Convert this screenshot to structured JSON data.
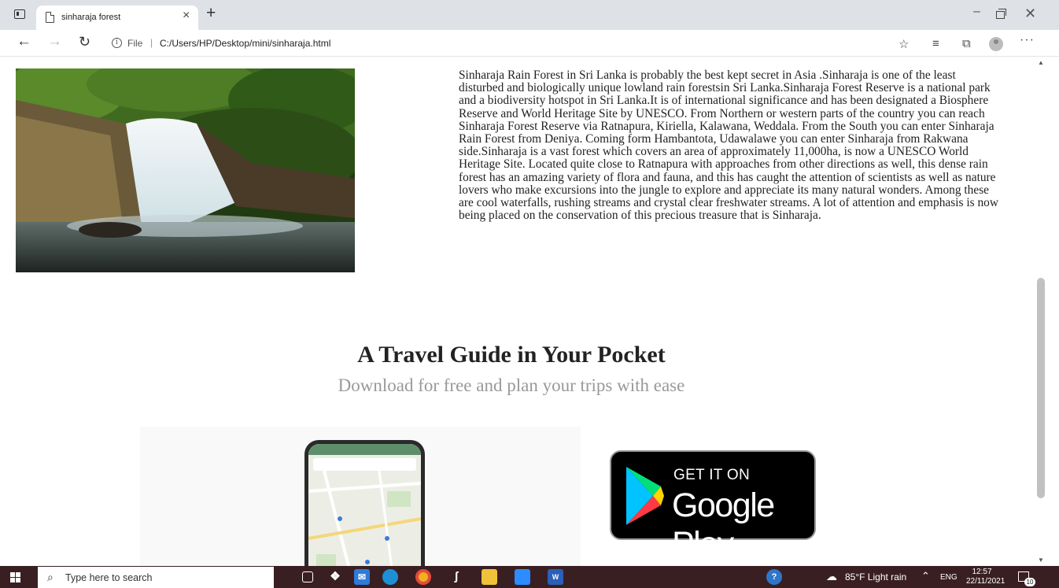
{
  "browser": {
    "tab_title": "sinharaja forest",
    "tab_close": "×",
    "new_tab": "+",
    "address": {
      "security_label": "File",
      "separator": "|",
      "url": "C:/Users/HP/Desktop/mini/sinharaja.html"
    },
    "window_controls": {
      "minimize": "–",
      "close": "✕"
    },
    "toolbar": {
      "more": "···"
    }
  },
  "page": {
    "description": "Sinharaja Rain Forest in Sri Lanka is probably the best kept secret in Asia .Sinharaja is one of the least disturbed and biologically unique lowland rain forestsin Sri Lanka.Sinharaja Forest Reserve is a national park and a biodiversity hotspot in Sri Lanka.It is of international significance and has been designated a Biosphere Reserve and World Heritage Site by UNESCO. From Northern or western parts of the country you can reach Sinharaja Forest Reserve via Ratnapura, Kiriella, Kalawana, Weddala. From the South you can enter Sinharaja Rain Forest from Deniya. Coming form Hambantota, Udawalawe you can enter Sinharaja from Rakwana side.Sinharaja is a vast forest which covers an area of approximately 11,000ha, is now a UNESCO World Heritage Site. Located quite close to Ratnapura with approaches from other directions as well, this dense rain forest has an amazing variety of flora and fauna, and this has caught the attention of scientists as well as nature lovers who make excursions into the jungle to explore and appreciate its many natural wonders. Among these are cool waterfalls, rushing streams and crystal clear freshwater streams. A lot of attention and emphasis is now being placed on the conservation of this precious treasure that is Sinharaja.",
    "promo_title": "A Travel Guide in Your Pocket",
    "promo_subtitle": "Download for free and plan your trips with ease",
    "store_badge": {
      "small": "GET IT ON",
      "big": "Google Play"
    }
  },
  "taskbar": {
    "search_placeholder": "Type here to search",
    "weather": "85°F  Light rain",
    "language": "ENG",
    "time": "12:57",
    "date": "22/11/2021",
    "notification_count": "10"
  },
  "icons": [
    "tab-actions-icon",
    "page-icon",
    "back-icon",
    "forward-icon",
    "reload-icon",
    "info-icon",
    "add-favorite-icon",
    "favorites-icon",
    "collections-icon",
    "profile-icon",
    "more-icon",
    "windows-start-icon",
    "search-icon",
    "task-view-icon",
    "dropbox-icon",
    "mail-icon",
    "edge-icon",
    "chrome-icon",
    "app-icon",
    "file-explorer-icon",
    "zoom-icon",
    "word-icon",
    "help-icon",
    "weather-icon",
    "chevron-up-icon",
    "notification-icon"
  ],
  "colors": {
    "taskbar": "#3a1f22",
    "tabstrip": "#dee1e6",
    "subtitle": "#999999"
  }
}
